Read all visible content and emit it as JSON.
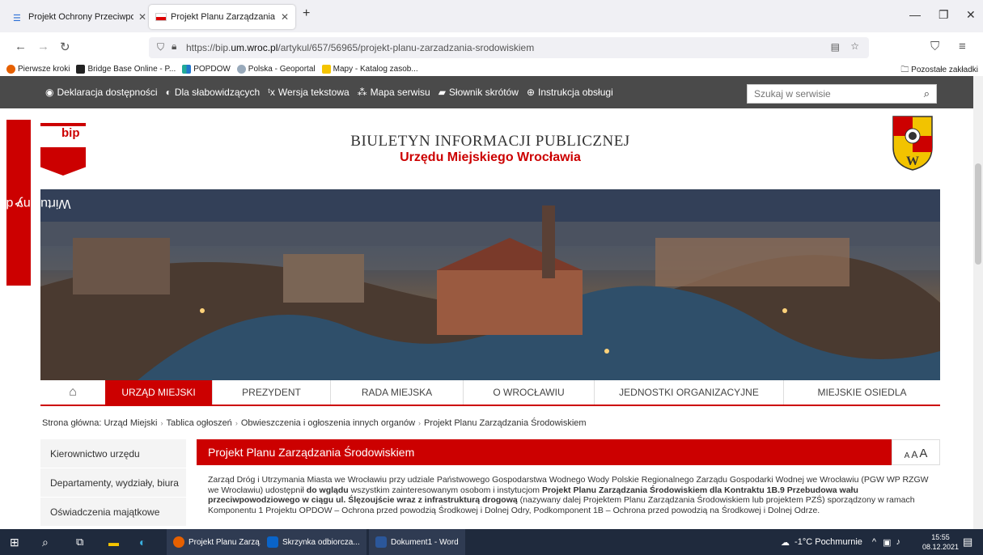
{
  "browser": {
    "tabs": [
      {
        "label": "Projekt Ochrony Przeciwpowod"
      },
      {
        "label": "Projekt Planu Zarządzania Środ"
      }
    ],
    "new_tab": "+",
    "url_host_pre": "https://bip.",
    "url_host": "um.wroc.pl",
    "url_path": "/artykul/657/56965/projekt-planu-zarzadzania-srodowiskiem",
    "bookmarks": [
      "Pierwsze kroki",
      "Bridge Base Online - P...",
      "POPDOW",
      "Polska - Geoportal",
      "Mapy - Katalog zasob..."
    ],
    "bookmarks_other": "Pozostałe zakładki"
  },
  "a11y": {
    "items": [
      "Deklaracja dostępności",
      "Dla słabowidzących",
      "Wersja tekstowa",
      "Mapa serwisu",
      "Słownik skrótów",
      "Instrukcja obsługi"
    ],
    "search_placeholder": "Szukaj w serwisie"
  },
  "header": {
    "logo": "bip",
    "title": "BIULETYN INFORMACJI PUBLICZNEJ",
    "subtitle": "Urzędu Miejskiego Wrocławia"
  },
  "virtual_assistant": "Wirtualny doradca",
  "mainnav": [
    "URZĄD MIEJSKI",
    "PREZYDENT",
    "RADA MIEJSKA",
    "O WROCŁAWIU",
    "JEDNOSTKI ORGANIZACYJNE",
    "MIEJSKIE OSIEDLA"
  ],
  "breadcrumb": {
    "prefix": "Strona główna:",
    "items": [
      "Urząd Miejski",
      "Tablica ogłoszeń",
      "Obwieszczenia i ogłoszenia innych organów",
      "Projekt Planu Zarządzania Środowiskiem"
    ]
  },
  "sidenav": [
    "Kierownictwo urzędu",
    "Departamenty, wydziały, biura",
    "Oświadczenia majątkowe"
  ],
  "article": {
    "title": "Projekt Planu Zarządzania Środowiskiem",
    "font_sizes": [
      "A",
      "A",
      "A"
    ],
    "p1_a": "Zarząd Dróg i Utrzymania Miasta we Wrocławiu przy udziale Państwowego Gospodarstwa Wodnego Wody Polskie Regionalnego Zarządu Gospodarki Wodnej we Wrocławiu (PGW WP RZGW we Wrocławiu) udostępnił ",
    "p1_b": "do wglądu",
    "p1_c": " wszystkim zainteresowanym osobom i instytucjom ",
    "p1_d": "Projekt Planu Zarządzania Środowiskiem dla Kontraktu 1B.9 Przebudowa wału przeciwpowodziowego w ciągu ul. Ślęzoujście wraz z infrastrukturą drogową",
    "p1_e": " (nazywany dalej Projektem Planu Zarządzania Środowiskiem lub projektem PZŚ) sporządzony w ramach Komponentu 1 Projektu OPDOW – Ochrona przed powodzią Środkowej i Dolnej Odry, Podkomponent 1B – Ochrona przed powodzią na Środkowej i Dolnej Odrze."
  },
  "taskbar": {
    "apps": [
      "Projekt Planu Zarzą...",
      "Skrzynka odbiorcza...",
      "Dokument1 - Word"
    ],
    "weather": "-1°C Pochmurnie",
    "time": "15:55",
    "date": "08.12.2021"
  },
  "colors": {
    "accent": "#cc0000",
    "a11y_bar": "#4a4a4a",
    "taskbar": "#1f2a3d"
  }
}
